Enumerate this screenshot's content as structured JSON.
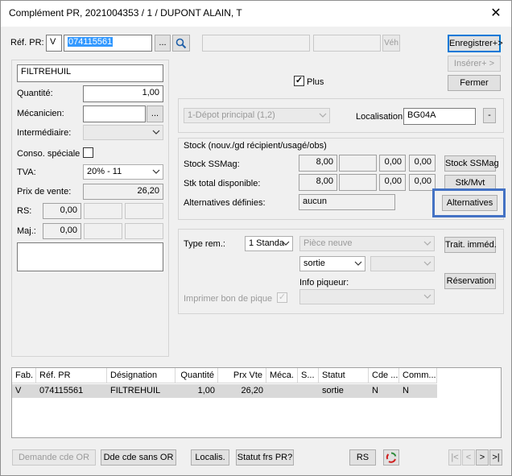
{
  "window": {
    "title": "Complément PR, 2021004353 / 1 / DUPONT ALAIN, T",
    "close_symbol": "✕"
  },
  "header": {
    "ref_pr_label": "Réf. PR:",
    "ref_prefix": "V",
    "ref_value": "074115561",
    "browse_label": "...",
    "veh_label": "Véh"
  },
  "actions": {
    "save": "Enregistrer+>",
    "insert": "Insérer+ >",
    "close": "Fermer"
  },
  "left": {
    "designation": "FILTREHUIL",
    "quantite_label": "Quantité:",
    "quantite_value": "1,00",
    "mecanicien_label": "Mécanicien:",
    "mecanicien_value": "",
    "mecanicien_browse": "...",
    "intermediaire_label": "Intermédiaire:",
    "intermediaire_value": "",
    "conso_label": "Conso. spéciale",
    "tva_label": "TVA:",
    "tva_value": "20% - 11",
    "prix_label": "Prix de vente:",
    "prix_value": "26,20",
    "rs_label": "RS:",
    "rs_value": "0,00",
    "maj_label": "Maj.:",
    "maj_value": "0,00",
    "note": ""
  },
  "right": {
    "plus_label": "Plus",
    "plus_checked": "✓",
    "depot_value": "1-Dépot principal (1,2)",
    "localisation_label": "Localisation:",
    "localisation_value": "BG04A",
    "localisation_btn": "-",
    "stock_group_title": "Stock (nouv./gd récipient/usagé/obs)",
    "stock_ssmag_label": "Stock SSMag:",
    "stock_ssmag_values": [
      "8,00",
      "",
      "0,00",
      "0,00"
    ],
    "stock_total_label": "Stk total disponible:",
    "stock_total_values": [
      "8,00",
      "",
      "0,00",
      "0,00"
    ],
    "alternatives_label": "Alternatives définies:",
    "alternatives_value": "aucun",
    "btn_stock_ssmag": "Stock SSMag",
    "btn_stk_mvt": "Stk/Mvt",
    "btn_alternatives": "Alternatives",
    "type_rem_label": "Type rem.:",
    "type_rem_value": "1 Standa",
    "piece_value": "Pièce neuve",
    "sortie_value": "sortie",
    "info_piqueur_label": "Info piqueur:",
    "imprimer_label": "Imprimer bon de pique",
    "imprimer_checked": "✓",
    "btn_trait": "Trait. imméd.",
    "btn_reservation": "Réservation",
    "highlight_color": "#4472c4"
  },
  "table": {
    "columns": [
      "Fab.",
      "Réf. PR",
      "Désignation",
      "Quantité",
      "Prx Vte",
      "Méca.",
      "S...",
      "Statut",
      "Cde ...",
      "Comm..."
    ],
    "rows": [
      [
        "V",
        "074115561",
        "FILTREHUIL",
        "1,00",
        "26,20",
        "",
        "",
        "sortie",
        "N",
        "N"
      ]
    ]
  },
  "footer": {
    "demande_cde_or": "Demande cde OR",
    "dde_cde_sans_or": "Dde cde sans OR",
    "localis": "Localis.",
    "statut_frs": "Statut frs PR?",
    "rs": "RS",
    "nav_first": "|<",
    "nav_prev": "<",
    "nav_next": ">",
    "nav_last": ">|"
  }
}
